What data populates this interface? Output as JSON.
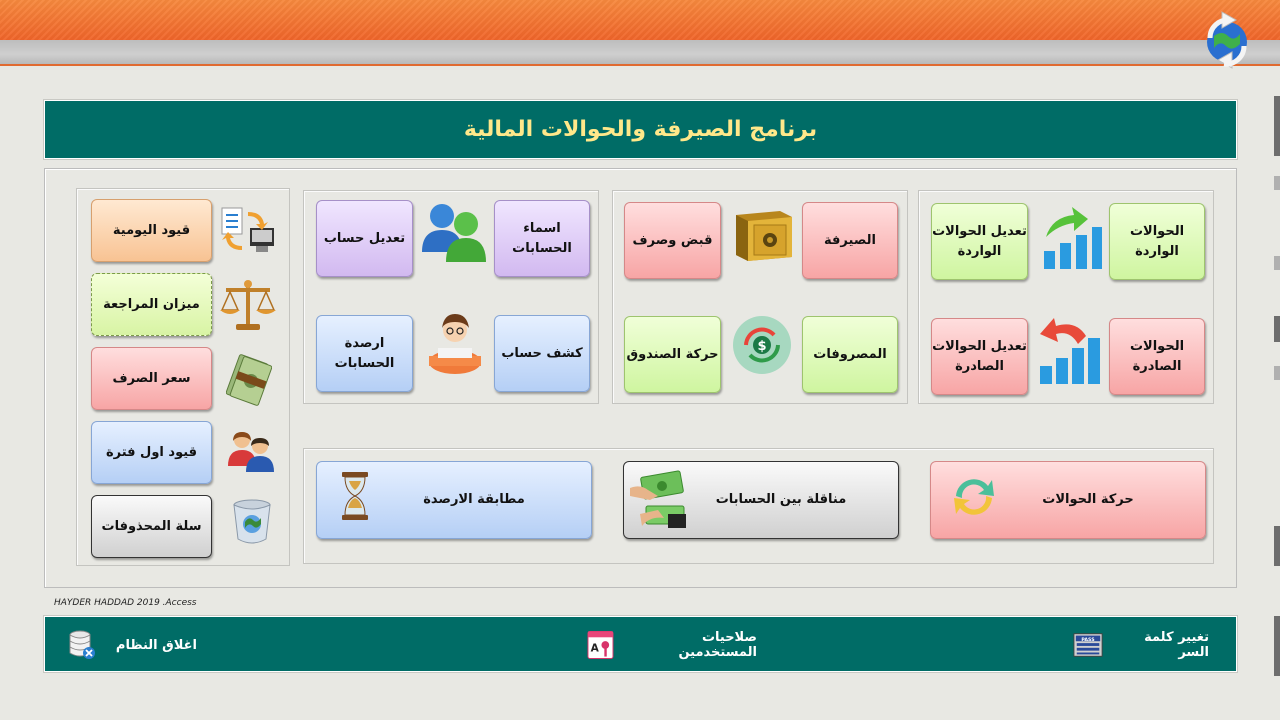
{
  "app": {
    "title": "برنامج الصيرفة والحوالات المالية",
    "credit": "HAYDER HADDAD 2019 .Access"
  },
  "colors": {
    "header_teal": "#006c66",
    "title_text": "#ffe88a",
    "top_bar_orange": "#f0652a",
    "background": "#e8e8e3"
  },
  "transfers_group": {
    "incoming": "الحوالات الواردة",
    "edit_incoming": "تعديل الحوالات الواردة",
    "outgoing": "الحوالات الصادرة",
    "edit_outgoing": "تعديل الحوالات الصادرة"
  },
  "exchange_group": {
    "exchange": "الصيرفة",
    "receipts": "قبض وصرف",
    "expenses": "المصروفات",
    "cashbox": "حركة الصندوق"
  },
  "accounts_group": {
    "account_names": "اسماء الحسابات",
    "edit_account": "تعديل حساب",
    "statement": "كشف حساب",
    "balances": "ارصدة الحسابات"
  },
  "bottom_group": {
    "transfers_movement": "حركة الحوالات",
    "account_transfer": "مناقلة  بين الحسابات",
    "balance_match": "مطابقة الارصدة"
  },
  "side_group": {
    "daily_entries": "قيود اليومية",
    "trial_balance": "ميزان المراجعة",
    "exchange_rate": "سعر الصرف",
    "opening_entries": "قيود  اول فترة",
    "recycle_bin": "سلة المحذوفات"
  },
  "footer": {
    "change_password": "تغيير كلمة السر",
    "pass_label": "PASS",
    "permissions": "صلاحيات المستخدمين",
    "close_system": "اغلاق النظام"
  }
}
